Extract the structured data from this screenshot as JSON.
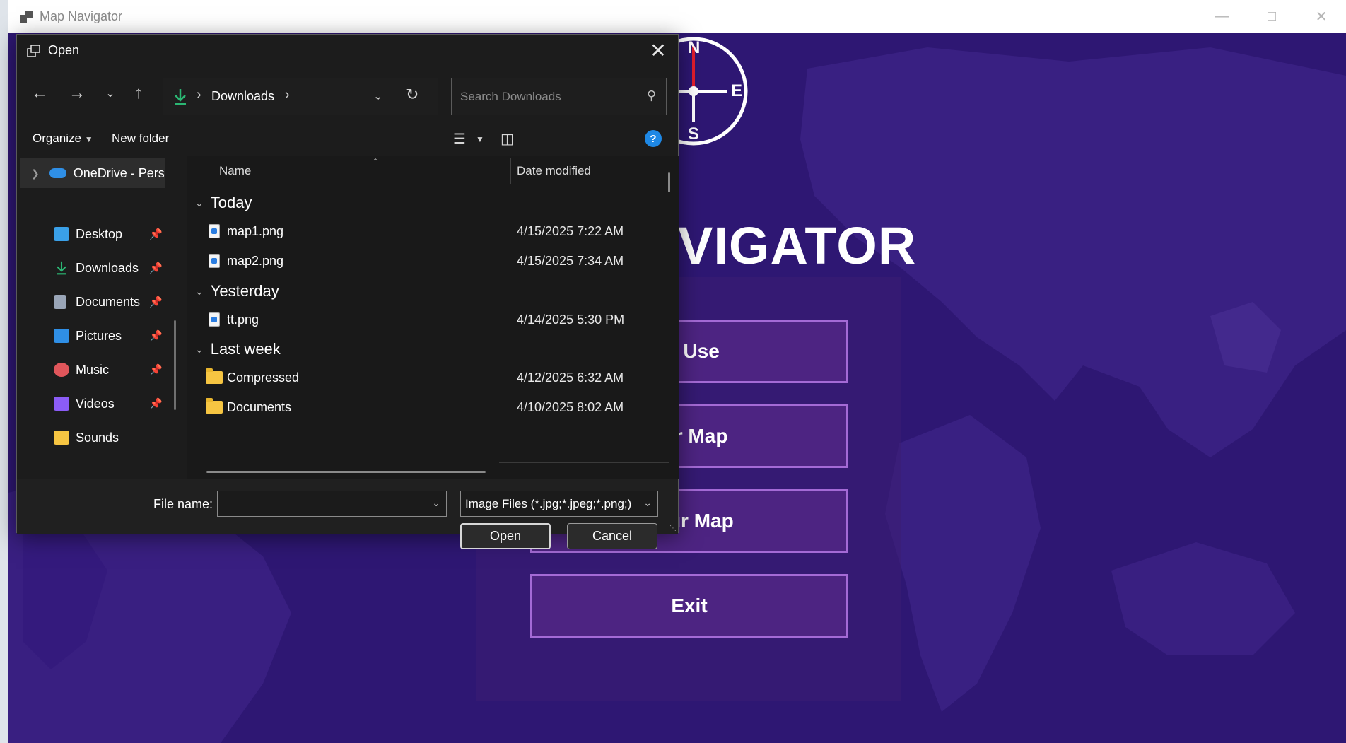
{
  "app": {
    "title": "Map Navigator",
    "heading_visible": "VIGATOR",
    "compass": {
      "north": "N",
      "east": "E",
      "south": "S"
    },
    "menu": [
      {
        "label": "to Use"
      },
      {
        "label": "our Map"
      },
      {
        "label": "Your Map"
      },
      {
        "label": "Exit"
      }
    ],
    "colors": {
      "background": "#2e1773",
      "button": "#4d2482",
      "button_border": "#a46ad6"
    }
  },
  "dialog": {
    "title": "Open",
    "address": {
      "current_folder": "Downloads"
    },
    "search": {
      "placeholder": "Search Downloads",
      "value": ""
    },
    "toolbar": {
      "organize": "Organize",
      "new_folder": "New folder",
      "help": "?"
    },
    "nav_pane": {
      "onedrive": "OneDrive - Pers",
      "quick_access": [
        {
          "label": "Desktop",
          "icon": "desktop-icon",
          "color": "#3aa0e8"
        },
        {
          "label": "Downloads",
          "icon": "downloads-icon",
          "color": "#2bb673"
        },
        {
          "label": "Documents",
          "icon": "documents-icon",
          "color": "#9aa6b8"
        },
        {
          "label": "Pictures",
          "icon": "pictures-icon",
          "color": "#2f8fe6"
        },
        {
          "label": "Music",
          "icon": "music-icon",
          "color": "#e0565b"
        },
        {
          "label": "Videos",
          "icon": "videos-icon",
          "color": "#8b5cf6"
        },
        {
          "label": "Sounds",
          "icon": "folder-icon",
          "color": "#f6c542"
        }
      ]
    },
    "columns": {
      "name": "Name",
      "date_modified": "Date modified"
    },
    "groups": [
      {
        "label": "Today",
        "files": [
          {
            "name": "map1.png",
            "date": "4/15/2025 7:22 AM",
            "type": "image"
          },
          {
            "name": "map2.png",
            "date": "4/15/2025 7:34 AM",
            "type": "image"
          }
        ]
      },
      {
        "label": "Yesterday",
        "files": [
          {
            "name": "tt.png",
            "date": "4/14/2025 5:30 PM",
            "type": "image"
          }
        ]
      },
      {
        "label": "Last week",
        "files": [
          {
            "name": "Compressed",
            "date": "4/12/2025 6:32 AM",
            "type": "folder"
          },
          {
            "name": "Documents",
            "date": "4/10/2025 8:02 AM",
            "type": "folder"
          }
        ]
      }
    ],
    "file_name_label": "File name:",
    "file_name_value": "",
    "file_type": "Image Files (*.jpg;*.jpeg;*.png;)",
    "open_button": "Open",
    "cancel_button": "Cancel"
  }
}
